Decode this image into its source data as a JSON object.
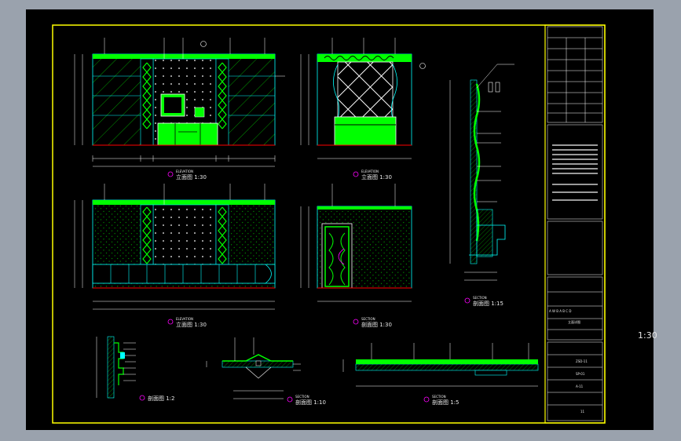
{
  "scale_label": "1:30",
  "drawings": {
    "elev1": {
      "title_en": "ELEVATION",
      "title_cn": "立面图 1:30"
    },
    "elev2": {
      "title_en": "ELEVATION",
      "title_cn": "立面图 1:30"
    },
    "elev3": {
      "title_en": "ELEVATION",
      "title_cn": "立面图 1:30"
    },
    "sect1": {
      "title_en": "SECTION",
      "title_cn": "剖面图 1:30"
    },
    "sect2": {
      "title_en": "SECTION",
      "title_cn": "剖面图 1:15"
    },
    "detail_a": {
      "title_cn": "剖面图 1:2"
    },
    "detail_b": {
      "title_en": "SECTION",
      "title_cn": "剖面图 1:10"
    },
    "detail_c": {
      "title_en": "SECTION",
      "title_cn": "剖面图 1:5"
    }
  },
  "title_block": {
    "project": "A  W  B  A  B  C  D",
    "drawing": "立面详图",
    "sheet": "11",
    "code": "ZSD-11",
    "field_a": "SP-01",
    "field_b": "A-11"
  },
  "colors": {
    "frame": "#ffff00",
    "accent": "#00ff00",
    "cyan": "#00ffff",
    "magenta": "#ff00ff",
    "white": "#ffffff",
    "red": "#ff0000"
  }
}
